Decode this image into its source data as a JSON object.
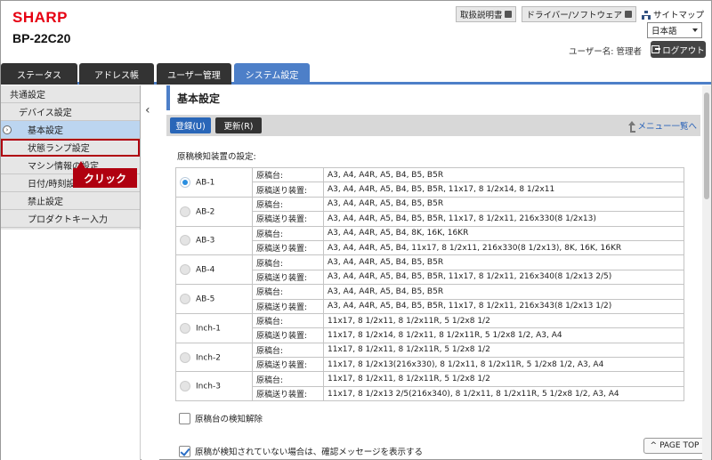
{
  "header": {
    "brand": "SHARP",
    "model": "BP-22C20",
    "links": [
      "取扱説明書",
      "ドライバー/ソフトウェア"
    ],
    "sitemap": "サイトマップ",
    "language": "日本語",
    "user_label": "ユーザー名: 管理者",
    "logout": "ログアウト"
  },
  "tabs": [
    "ステータス",
    "アドレス帳",
    "ユーザー管理",
    "システム設定"
  ],
  "sidebar": {
    "items": [
      "共通設定",
      "デバイス設定",
      "基本設定",
      "状態ランプ設定",
      "マシン情報の設定",
      "日付/時刻設定",
      "禁止設定",
      "プロダクトキー入力"
    ]
  },
  "callout": "クリック",
  "main": {
    "title": "基本設定",
    "btn_register": "登録(U)",
    "btn_update": "更新(R)",
    "menu_link": "メニュー一覧へ",
    "section_label": "原稿検知装置の設定:",
    "rows": [
      {
        "name": "AB-1",
        "checked": true,
        "platen": "A3, A4, A4R, A5, B4, B5, B5R",
        "feeder": "A3, A4, A4R, A5, B4, B5, B5R, 11x17, 8 1/2x14, 8 1/2x11"
      },
      {
        "name": "AB-2",
        "checked": false,
        "platen": "A3, A4, A4R, A5, B4, B5, B5R",
        "feeder": "A3, A4, A4R, A5, B4, B5, B5R, 11x17, 8 1/2x11, 216x330(8 1/2x13)"
      },
      {
        "name": "AB-3",
        "checked": false,
        "platen": "A3, A4, A4R, A5, B4, 8K, 16K, 16KR",
        "feeder": "A3, A4, A4R, A5, B4, 11x17, 8 1/2x11, 216x330(8 1/2x13), 8K, 16K, 16KR"
      },
      {
        "name": "AB-4",
        "checked": false,
        "platen": "A3, A4, A4R, A5, B4, B5, B5R",
        "feeder": "A3, A4, A4R, A5, B4, B5, B5R, 11x17, 8 1/2x11, 216x340(8 1/2x13 2/5)"
      },
      {
        "name": "AB-5",
        "checked": false,
        "platen": "A3, A4, A4R, A5, B4, B5, B5R",
        "feeder": "A3, A4, A4R, A5, B4, B5, B5R, 11x17, 8 1/2x11, 216x343(8 1/2x13 1/2)"
      },
      {
        "name": "Inch-1",
        "checked": false,
        "platen": "11x17, 8 1/2x11, 8 1/2x11R, 5 1/2x8 1/2",
        "feeder": "11x17, 8 1/2x14, 8 1/2x11, 8 1/2x11R, 5 1/2x8 1/2, A3, A4"
      },
      {
        "name": "Inch-2",
        "checked": false,
        "platen": "11x17, 8 1/2x11, 8 1/2x11R, 5 1/2x8 1/2",
        "feeder": "11x17, 8 1/2x13(216x330), 8 1/2x11, 8 1/2x11R, 5 1/2x8 1/2, A3, A4"
      },
      {
        "name": "Inch-3",
        "checked": false,
        "platen": "11x17, 8 1/2x11, 8 1/2x11R, 5 1/2x8 1/2",
        "feeder": "11x17, 8 1/2x13 2/5(216x340), 8 1/2x11, 8 1/2x11R, 5 1/2x8 1/2, A3, A4"
      }
    ],
    "platen_label": "原稿台:",
    "feeder_label": "原稿送り装置:",
    "cb_disable": "原稿台の検知解除",
    "cb_confirm": "原稿が検知されていない場合は、確認メッセージを表示する",
    "pagetop": "PAGE TOP"
  }
}
